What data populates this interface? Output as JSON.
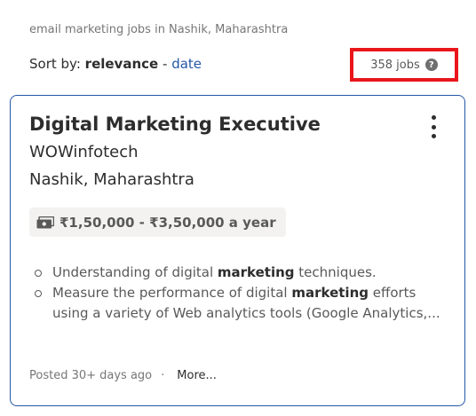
{
  "search": {
    "context": "email marketing jobs in Nashik, Maharashtra"
  },
  "sort": {
    "prefix": "Sort by:",
    "active": "relevance",
    "separator": "-",
    "alternate": "date"
  },
  "results": {
    "count_label": "358 jobs",
    "help_icon": "question-circle-icon"
  },
  "job": {
    "title": "Digital Marketing Executive",
    "company": "WOWinfotech",
    "location": "Nashik, Maharashtra",
    "salary": "₹1,50,000 - ₹3,50,000 a year",
    "salary_icon": "money-icon",
    "menu_icon": "kebab-menu-icon",
    "snippet": [
      {
        "before": "Understanding of digital ",
        "highlight": "marketing",
        "after": " techniques."
      },
      {
        "before": "Measure the performance of digital ",
        "highlight": "marketing",
        "after": " efforts using a variety of Web analytics tools (Google Analytics,..."
      }
    ],
    "posted": "Posted 30+ days ago",
    "footer_separator": "·",
    "more_label": "More..."
  },
  "colors": {
    "link_blue": "#2557a7",
    "highlight_red": "#e8161b",
    "text_dark": "#2d2d2d",
    "text_muted": "#767676",
    "chip_bg": "#f3f2f1"
  }
}
